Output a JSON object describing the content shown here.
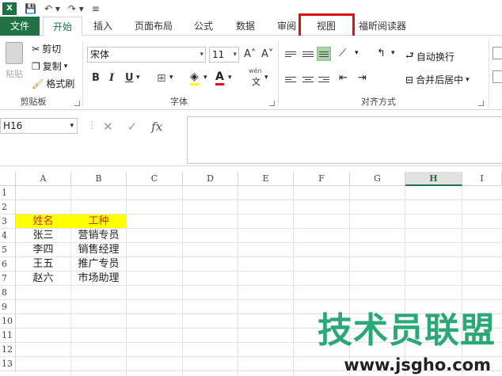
{
  "qat": {
    "logo": "X",
    "save_glyph": "💾",
    "undo_glyph": "↶ ▾",
    "redo_glyph": "↷ ▾",
    "more_glyph": "≡"
  },
  "tabs": {
    "file": "文件",
    "home": "开始",
    "insert": "插入",
    "page_layout": "页面布局",
    "formulas": "公式",
    "data": "数据",
    "review": "审阅",
    "view": "视图",
    "reader": "福昕阅读器"
  },
  "clipboard": {
    "paste": "粘贴",
    "cut": "剪切",
    "copy": "复制",
    "format_painter": "格式刷",
    "group": "剪贴板"
  },
  "font": {
    "name": "宋体",
    "size": "11",
    "grow": "A˄",
    "shrink": "A˅",
    "bold": "B",
    "italic": "I",
    "underline": "U",
    "group": "字体",
    "wen": "wén",
    "wen_char": "文"
  },
  "alignment": {
    "wrap": "自动换行",
    "merge": "合并后居中",
    "group": "对齐方式"
  },
  "formula_bar": {
    "name_box": "H16",
    "cancel": "✕",
    "enter": "✓",
    "fx": "fx",
    "content": ""
  },
  "grid": {
    "columns": [
      "A",
      "B",
      "C",
      "D",
      "E",
      "F",
      "G",
      "H",
      "I"
    ],
    "selected_column": "H",
    "rows": [
      "1",
      "2",
      "3",
      "4",
      "5",
      "6",
      "7",
      "8",
      "9",
      "10",
      "11",
      "12",
      "13"
    ],
    "cells": {
      "a3": "姓名",
      "b3": "工种",
      "a4": "张三",
      "b4": "营销专员",
      "a5": "李四",
      "b5": "销售经理",
      "a6": "王五",
      "b6": "推广专员",
      "a7": "赵六",
      "b7": "市场助理"
    }
  },
  "colors": {
    "header_fill": "#ffff00",
    "header_text": "#c0392b",
    "accent": "#217346",
    "highlight": "#e01010"
  },
  "watermark": {
    "title": "技术员联盟",
    "url": "www.jsgho.com"
  }
}
